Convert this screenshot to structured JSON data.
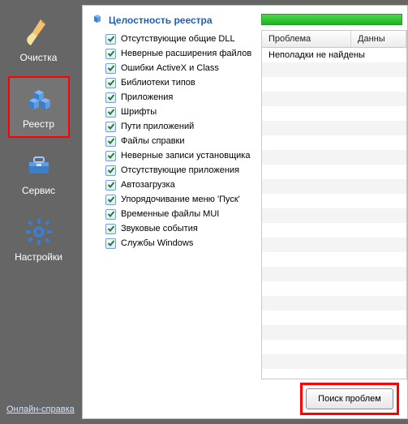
{
  "sidebar": {
    "items": [
      {
        "label": "Очистка"
      },
      {
        "label": "Реестр"
      },
      {
        "label": "Сервис"
      },
      {
        "label": "Настройки"
      }
    ],
    "help_link": "Онлайн-справка"
  },
  "section": {
    "title": "Целостность реестра"
  },
  "checklist": [
    "Отсутствующие общие DLL",
    "Неверные расширения файлов",
    "Ошибки ActiveX и Class",
    "Библиотеки типов",
    "Приложения",
    "Шрифты",
    "Пути приложений",
    "Файлы справки",
    "Неверные записи установщика",
    "Отсутствующие приложения",
    "Автозагрузка",
    "Упорядочивание меню 'Пуск'",
    "Временные файлы MUI",
    "Звуковые события",
    "Службы Windows"
  ],
  "results": {
    "columns": {
      "problem": "Проблема",
      "data": "Данны"
    },
    "rows": [
      {
        "problem": "Неполадки не найдены"
      }
    ]
  },
  "footer": {
    "scan_button": "Поиск проблем"
  }
}
